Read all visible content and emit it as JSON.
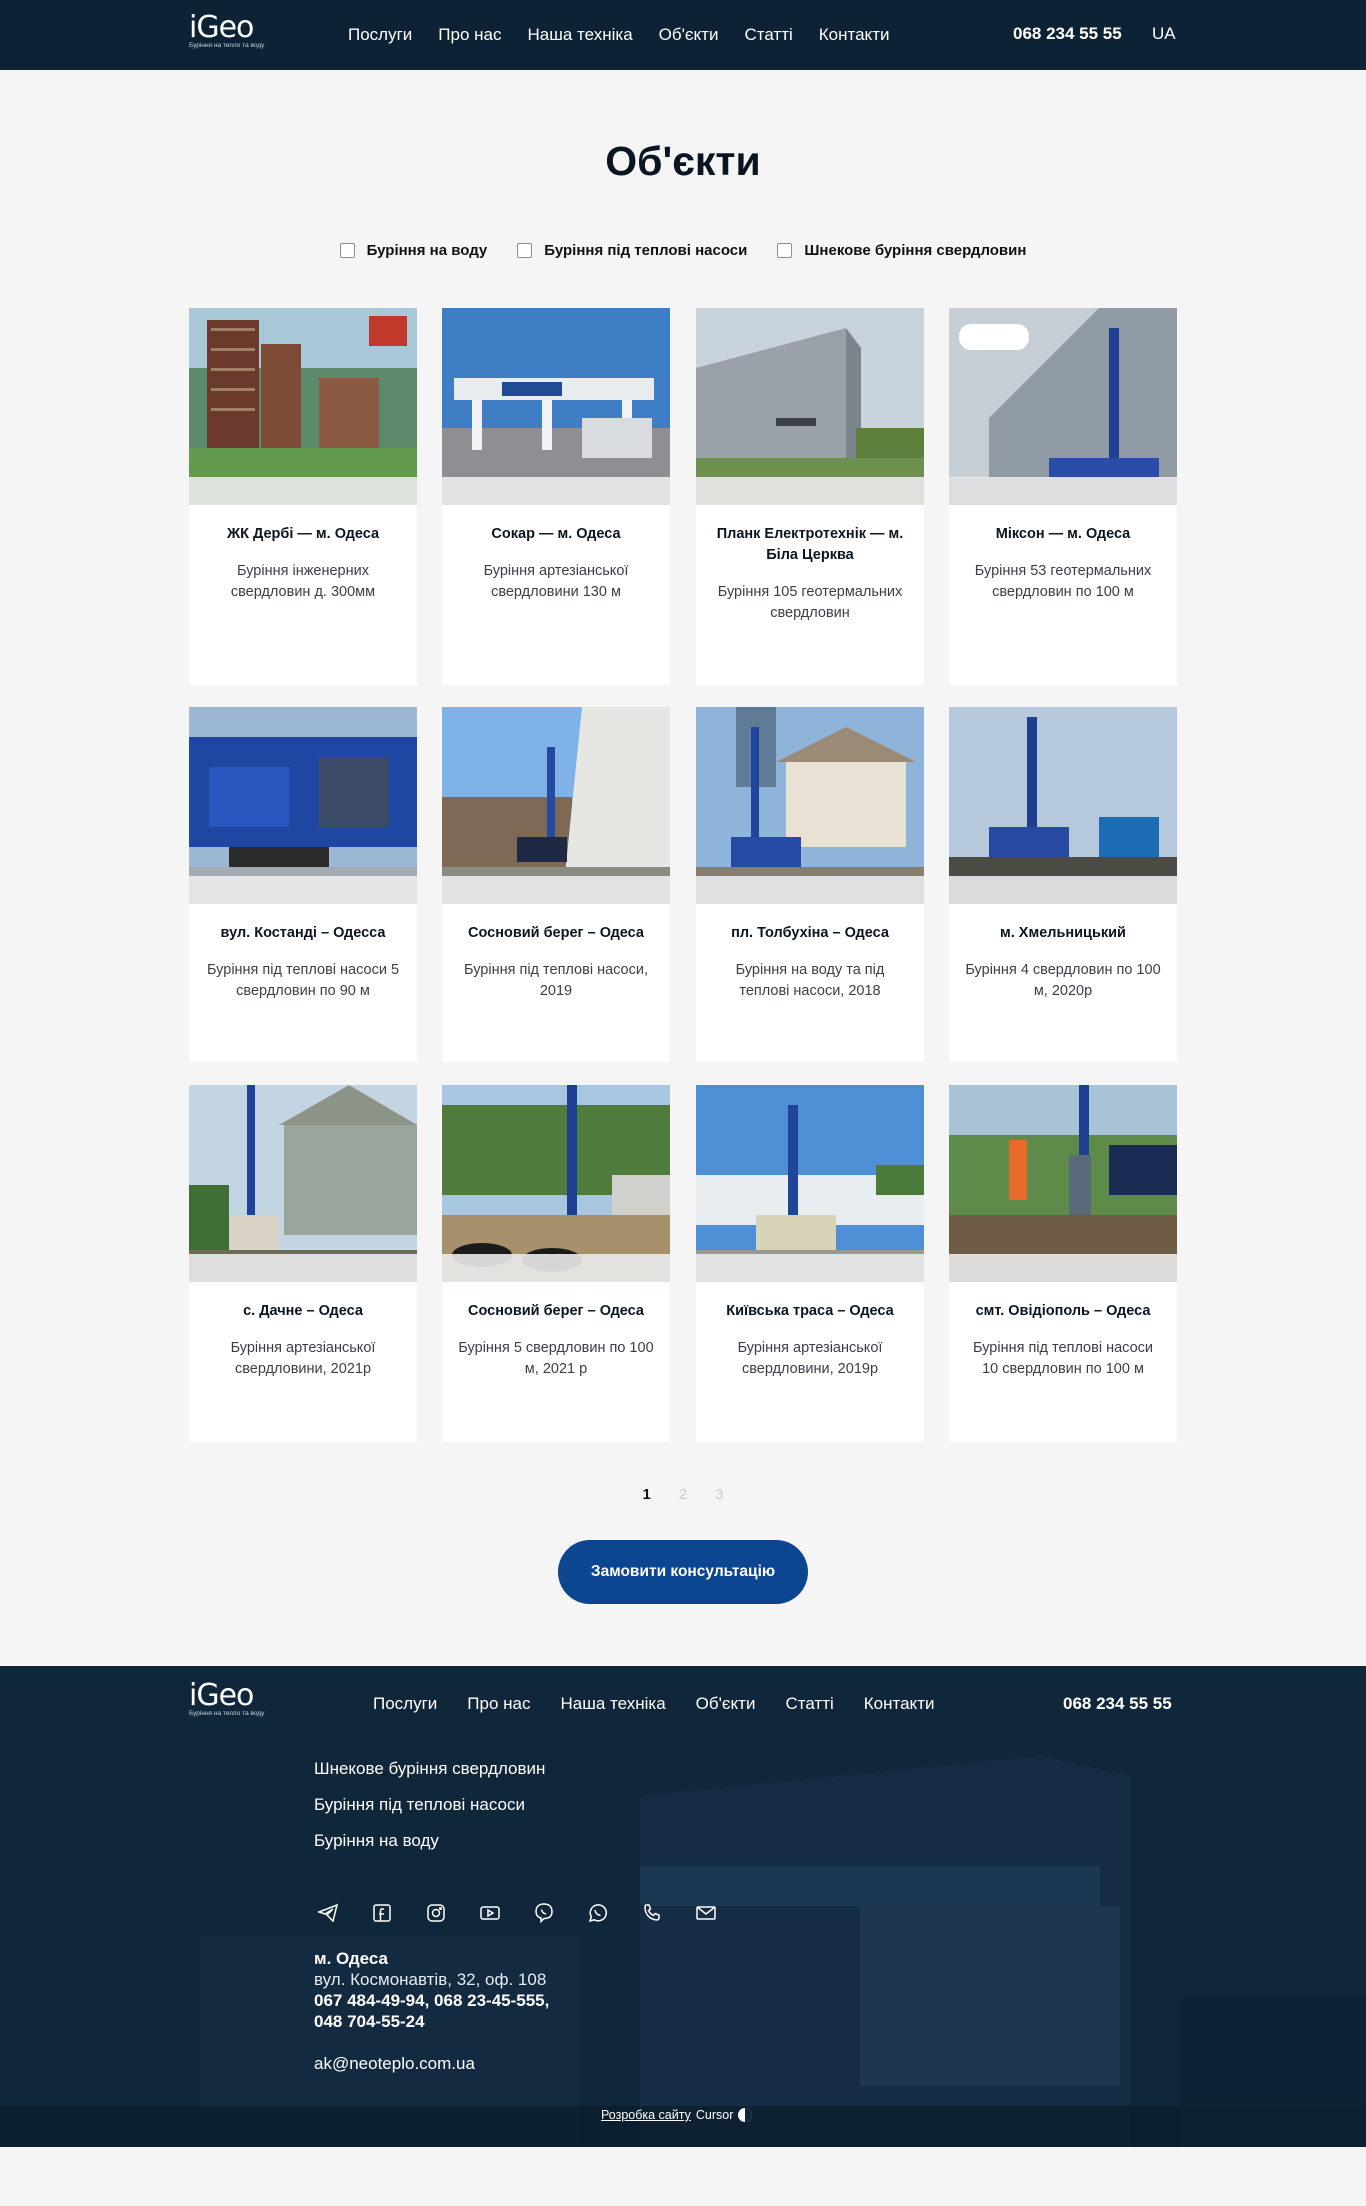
{
  "header": {
    "logo_text": "iGeo",
    "logo_tagline": "Буріння на тепло та воду",
    "nav": [
      "Послуги",
      "Про нас",
      "Наша техніка",
      "Об'єкти",
      "Статті",
      "Контакти"
    ],
    "phone": "068 234 55 55",
    "lang": "UA"
  },
  "main": {
    "title": "Об'єкти",
    "filters": [
      "Буріння на воду",
      "Буріння під теплові насоси",
      "Шнекове буріння свердловин"
    ],
    "cards": [
      {
        "title": "ЖК Дербі — м. Одеса",
        "desc": "Буріння інженерних свердловин д. 300мм",
        "image": "residential-towers-photo"
      },
      {
        "title": "Сокар — м. Одеса",
        "desc": "Буріння артезіанської свердловини 130 м",
        "image": "socar-gas-station-photo"
      },
      {
        "title": "Планк Електротехнік — м. Біла Церква",
        "desc": "Буріння 105 геотермальних свердловин",
        "image": "plank-factory-photo"
      },
      {
        "title": "Міксон — м. Одеса",
        "desc": "Буріння 53 геотермальних свердловин по 100 м",
        "image": "mixon-building-rig-photo"
      },
      {
        "title": "вул. Костанді – Одесса",
        "desc": "Буріння під теплові насоси 5 свердловин по 90 м",
        "image": "igeo-rig-on-truck-photo"
      },
      {
        "title": "Сосновий берег – Одеса",
        "desc": "Буріння під теплові насоси, 2019",
        "image": "rig-near-house-wall-photo"
      },
      {
        "title": "пл. Толбухіна – Одеса",
        "desc": "Буріння на воду та під теплові насоси, 2018",
        "image": "rig-at-mansion-photo"
      },
      {
        "title": "м. Хмельницький",
        "desc": "Буріння 4 свердловин по 100 м, 2020р",
        "image": "rig-on-site-photo"
      },
      {
        "title": "с. Дачне – Одеса",
        "desc": "Буріння артезіанської свердловини, 2021р",
        "image": "rig-at-village-house-photo"
      },
      {
        "title": "Сосновий берег – Одеса",
        "desc": "Буріння 5 свердловин по 100 м, 2021 р",
        "image": "rig-with-pipe-coils-photo"
      },
      {
        "title": "Київська траса – Одеса",
        "desc": "Буріння артезіанської свердловини, 2019р",
        "image": "rig-with-containers-photo"
      },
      {
        "title": "смт. Овідіополь – Одеса",
        "desc": "Буріння під теплові насоси 10 свердловин по 100 м",
        "image": "workers-at-rig-photo"
      }
    ],
    "pagination": {
      "pages": [
        "1",
        "2",
        "3"
      ],
      "current": "1"
    },
    "cta": "Замовити консультацію"
  },
  "footer": {
    "nav": [
      "Послуги",
      "Про нас",
      "Наша техніка",
      "Об'єкти",
      "Статті",
      "Контакти"
    ],
    "phone": "068 234 55 55",
    "services": [
      "Шнекове буріння свердловин",
      "Буріння під теплові насоси",
      "Буріння на воду"
    ],
    "socials": [
      "telegram-icon",
      "facebook-icon",
      "instagram-icon",
      "youtube-icon",
      "viber-icon",
      "whatsapp-icon",
      "phone-icon",
      "mail-icon"
    ],
    "city": "м. Одеса",
    "address": "вул. Космонавтів, 32, оф. 108",
    "phones_line1_a": "067 484-49-94",
    "phones_line1_b": "068 23-45-555",
    "phones_line2": "048 704-55-24",
    "email": "ak@neoteplo.com.ua",
    "credit_link": "Розробка сайту",
    "credit_brand": "Cursor"
  },
  "colors": {
    "header_bg": "#0d2234",
    "footer_bg": "#0f2539",
    "accent_button": "#0c4590",
    "page_bg": "#f5f5f6"
  }
}
